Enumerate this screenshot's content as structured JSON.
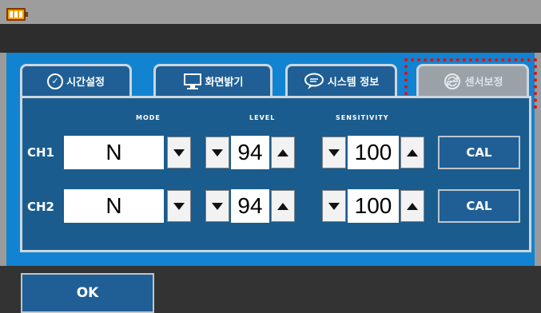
{
  "status": {
    "icon": "battery-icon"
  },
  "tabs": [
    {
      "label": "시간설정",
      "icon": "clock-icon"
    },
    {
      "label": "화면밝기",
      "icon": "monitor-icon"
    },
    {
      "label": "시스템 정보",
      "icon": "speech-bubble-icon"
    },
    {
      "label": "센서보정",
      "icon": "refresh-icon"
    }
  ],
  "columns": {
    "mode": "MODE",
    "level": "LEVEL",
    "sensitivity": "SENSITIVITY"
  },
  "channels": [
    {
      "label": "CH1",
      "mode": "N",
      "level": "94",
      "sensitivity": "100",
      "cal": "CAL"
    },
    {
      "label": "CH2",
      "mode": "N",
      "level": "94",
      "sensitivity": "100",
      "cal": "CAL"
    }
  ],
  "footer": {
    "ok": "OK"
  },
  "colors": {
    "panel": "#1283d0",
    "inner": "#1b5c8e",
    "button": "#1f5f95",
    "highlight": "#e01010"
  }
}
